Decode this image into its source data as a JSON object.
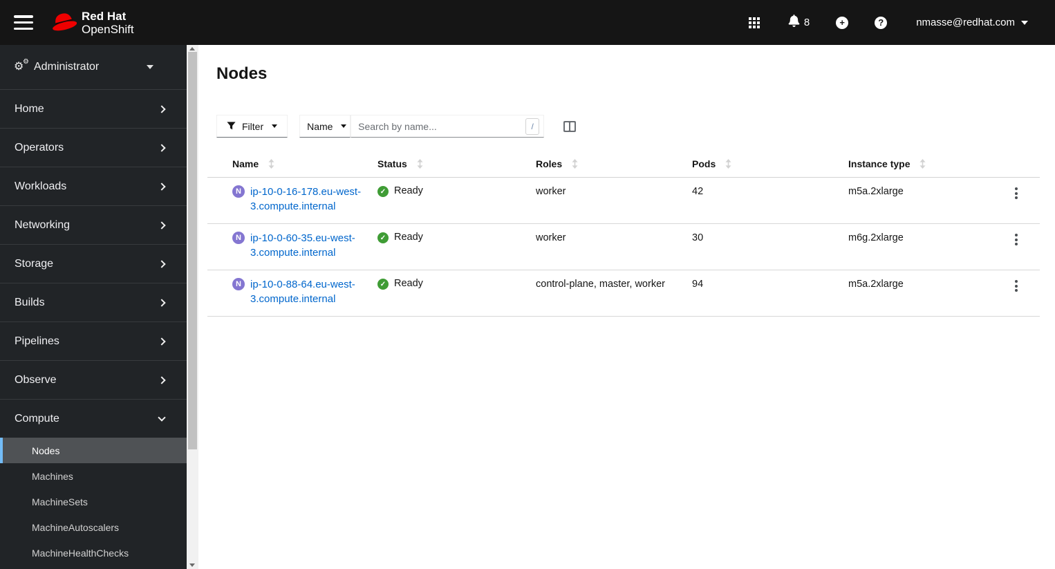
{
  "masthead": {
    "brand_line1": "Red Hat",
    "brand_line2": "OpenShift",
    "notification_count": "8",
    "username": "nmasse@redhat.com"
  },
  "sidebar": {
    "perspective": "Administrator",
    "items": [
      {
        "label": "Home"
      },
      {
        "label": "Operators"
      },
      {
        "label": "Workloads"
      },
      {
        "label": "Networking"
      },
      {
        "label": "Storage"
      },
      {
        "label": "Builds"
      },
      {
        "label": "Pipelines"
      },
      {
        "label": "Observe"
      }
    ],
    "compute": {
      "label": "Compute",
      "expanded": true,
      "selected_child": "Nodes",
      "children": [
        "Nodes",
        "Machines",
        "MachineSets",
        "MachineAutoscalers",
        "MachineHealthChecks"
      ]
    }
  },
  "page": {
    "title": "Nodes"
  },
  "toolbar": {
    "filter_label": "Filter",
    "name_label": "Name",
    "search_placeholder": "Search by name...",
    "shortcut_key": "/"
  },
  "table": {
    "columns": [
      "Name",
      "Status",
      "Roles",
      "Pods",
      "Instance type"
    ],
    "resource_abbr": "N",
    "rows": [
      {
        "name": "ip-10-0-16-178.eu-west-3.compute.internal",
        "status": "Ready",
        "roles": "worker",
        "pods": "42",
        "instance_type": "m5a.2xlarge"
      },
      {
        "name": "ip-10-0-60-35.eu-west-3.compute.internal",
        "status": "Ready",
        "roles": "worker",
        "pods": "30",
        "instance_type": "m6g.2xlarge"
      },
      {
        "name": "ip-10-0-88-64.eu-west-3.compute.internal",
        "status": "Ready",
        "roles": "control-plane, master, worker",
        "pods": "94",
        "instance_type": "m5a.2xlarge"
      }
    ]
  },
  "icons": {
    "cog_glyph": "⚙",
    "check_glyph": "✓",
    "plus_glyph": "+",
    "help_glyph": "?"
  },
  "colors": {
    "brand_red": "#ee0000",
    "masthead_bg": "#151515",
    "sidebar_bg": "#212427",
    "selected_item_bg": "#4f5255",
    "selected_item_border": "#73bcf7",
    "link_blue": "#0066cc",
    "status_green": "#3f9c35",
    "node_badge_purple": "#8476d1"
  }
}
